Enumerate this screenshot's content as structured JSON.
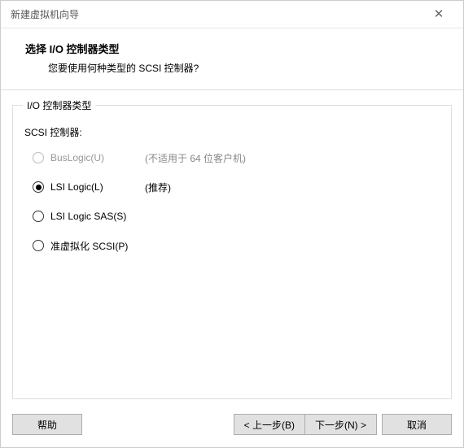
{
  "window": {
    "title": "新建虚拟机向导"
  },
  "header": {
    "title": "选择 I/O 控制器类型",
    "subtitle": "您要使用何种类型的 SCSI 控制器?"
  },
  "fieldset": {
    "legend": "I/O 控制器类型",
    "scsi_label": "SCSI 控制器:"
  },
  "options": [
    {
      "label": "BusLogic(U)",
      "hint": "(不适用于 64 位客户机)",
      "selected": false,
      "disabled": true
    },
    {
      "label": "LSI Logic(L)",
      "hint": "(推荐)",
      "selected": true,
      "disabled": false
    },
    {
      "label": "LSI Logic SAS(S)",
      "hint": "",
      "selected": false,
      "disabled": false
    },
    {
      "label": "准虚拟化 SCSI(P)",
      "hint": "",
      "selected": false,
      "disabled": false
    }
  ],
  "buttons": {
    "help": "帮助",
    "back": "< 上一步(B)",
    "next": "下一步(N) >",
    "cancel": "取消"
  }
}
